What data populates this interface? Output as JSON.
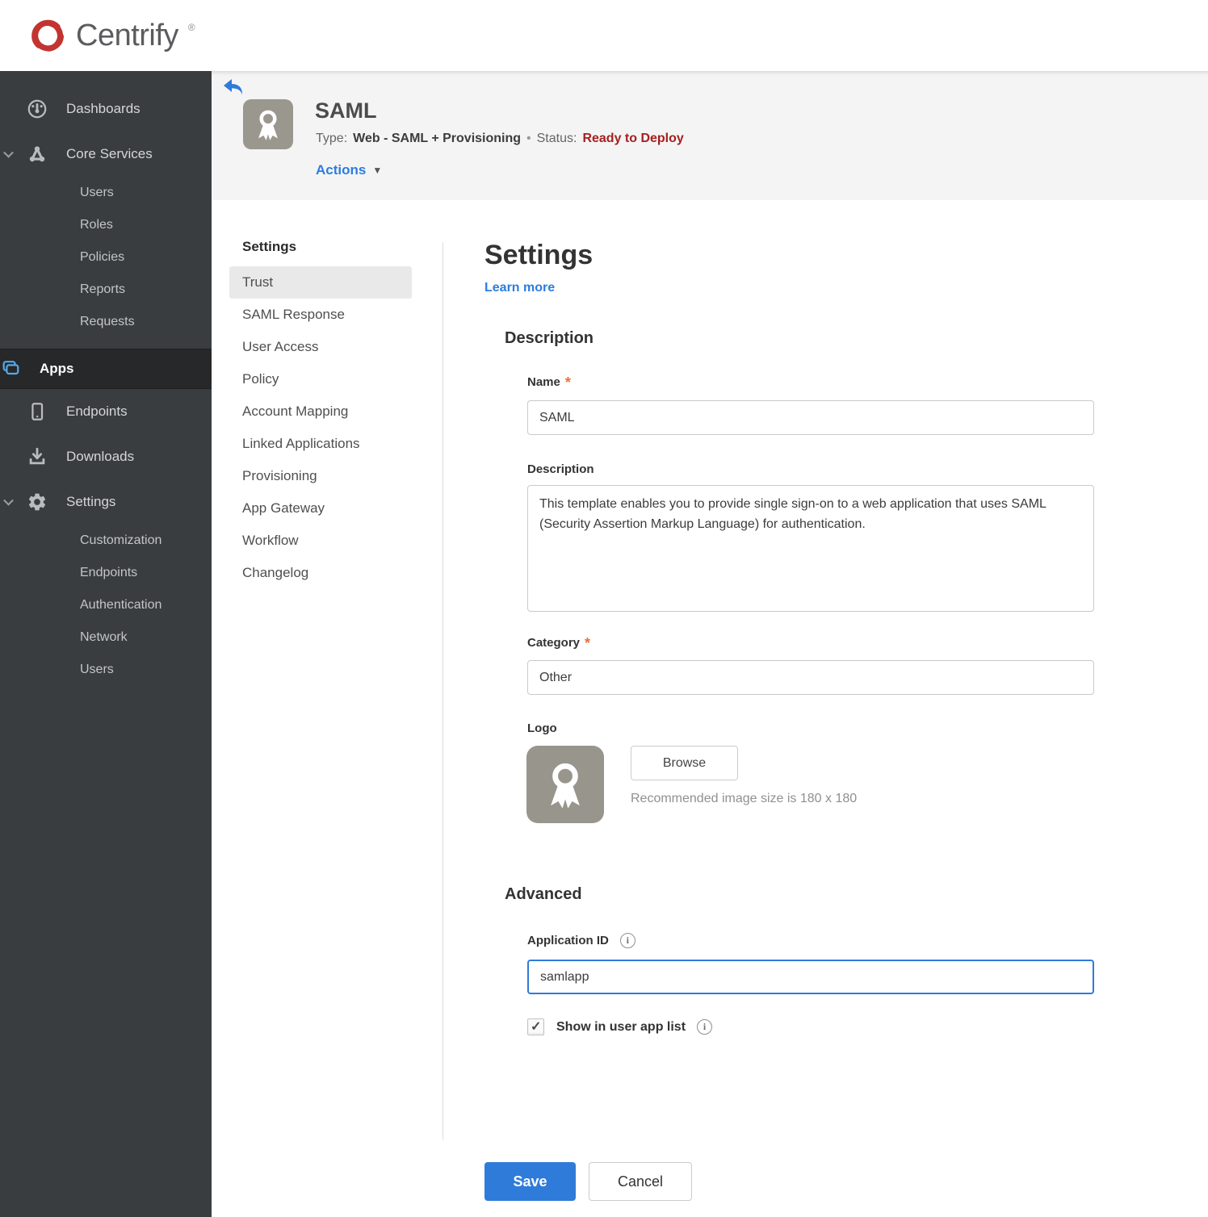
{
  "brand": {
    "name": "Centrify",
    "registered_mark": "®"
  },
  "icons": {
    "info": "i",
    "actions_caret": "▼"
  },
  "colors": {
    "accent_blue": "#2f7bd9",
    "link_blue": "#2b7de1",
    "status_red": "#a51f1f",
    "required_orange": "#e8713c",
    "apps_icon_blue": "#57a9e8",
    "brand_red": "#c23430",
    "sidebar_bg": "#3a3d3f",
    "sidebar_selected_bg": "#26282a",
    "header_band_bg": "#f4f4f4",
    "divider": "#dcdcdc",
    "input_border": "#c9c9c9"
  },
  "sidebar": {
    "dashboards": "Dashboards",
    "core_services": "Core Services",
    "core_children": [
      "Users",
      "Roles",
      "Policies",
      "Reports",
      "Requests"
    ],
    "apps": "Apps",
    "endpoints": "Endpoints",
    "downloads": "Downloads",
    "settings": "Settings",
    "settings_children": [
      "Customization",
      "Endpoints",
      "Authentication",
      "Network",
      "Users"
    ],
    "selected": "Apps"
  },
  "header": {
    "app_title": "SAML",
    "type_label": "Type:",
    "type_value": "Web - SAML + Provisioning",
    "separator": "•",
    "status_label": "Status:",
    "status_value": "Ready to Deploy",
    "actions_label": "Actions"
  },
  "subnav": {
    "title": "Settings",
    "selected": "Trust",
    "items": [
      "Trust",
      "SAML Response",
      "User Access",
      "Policy",
      "Account Mapping",
      "Linked Applications",
      "Provisioning",
      "App Gateway",
      "Workflow",
      "Changelog"
    ]
  },
  "main": {
    "title": "Settings",
    "learn_more": "Learn more",
    "required_marker": "*",
    "description_section": {
      "title": "Description",
      "name_label": "Name",
      "name_value": "SAML",
      "description_label": "Description",
      "description_value": "This template enables you to provide single sign-on to a web application that uses SAML (Security Assertion Markup Language) for authentication.",
      "category_label": "Category",
      "category_value": "Other",
      "logo_label": "Logo",
      "browse_button": "Browse",
      "logo_hint": "Recommended image size is 180 x 180"
    },
    "advanced_section": {
      "title": "Advanced",
      "application_id_label": "Application ID",
      "application_id_value": "samlapp",
      "show_in_user_app_list_label": "Show in user app list",
      "checkbox_checked": "checked"
    },
    "save_button": "Save",
    "cancel_button": "Cancel"
  }
}
